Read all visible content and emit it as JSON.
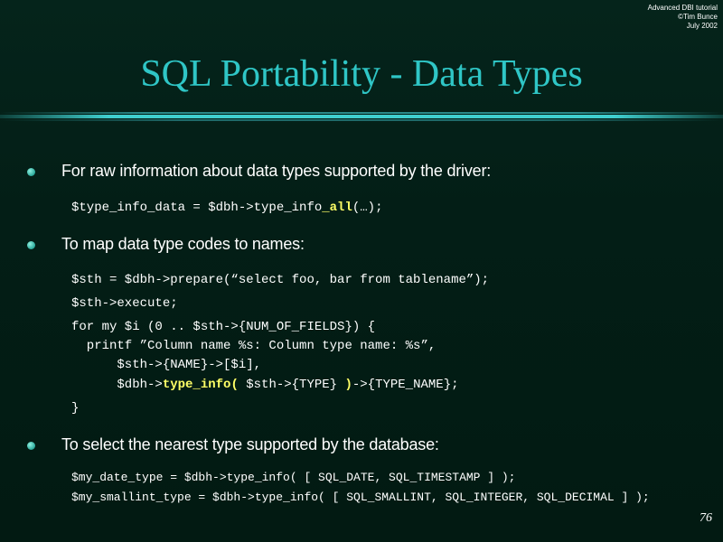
{
  "credit": {
    "line1": "Advanced DBI tutorial",
    "line2": "©Tim Bunce",
    "line3": "July 2002"
  },
  "title": "SQL Portability - Data Types",
  "bullets": [
    {
      "text": "For raw information about data types supported by the driver:"
    },
    {
      "text": "To map data type codes to names:"
    },
    {
      "text": "To select the nearest type supported by the database:"
    }
  ],
  "code1": {
    "pre": "$type_info_data = $dbh->type_info",
    "hl": "_all",
    "post": "(…);"
  },
  "code2": {
    "line1": "$sth = $dbh->prepare(“select foo, bar from tablename”);",
    "line2": "$sth->execute;",
    "line3": "for my $i (0 .. $sth->{NUM_OF_FIELDS}) {",
    "line4": "  printf ”Column name %s: Column type name: %s”,",
    "line5": "      $sth->{NAME}->[$i],",
    "line6_pre": "      $dbh->",
    "line6_hl1": "type_info(",
    "line6_mid": " $sth->{TYPE} ",
    "line6_hl2": ")",
    "line6_post": "->{TYPE_NAME};",
    "line7": "}"
  },
  "code3": {
    "line1": "$my_date_type = $dbh->type_info( [ SQL_DATE, SQL_TIMESTAMP ] );",
    "line2": "$my_smallint_type = $dbh->type_info( [ SQL_SMALLINT, SQL_INTEGER, SQL_DECIMAL ] );"
  },
  "page_number": "76",
  "colors": {
    "title": "#2fc6c6",
    "highlight": "#ffff66",
    "background": "#03201a"
  }
}
